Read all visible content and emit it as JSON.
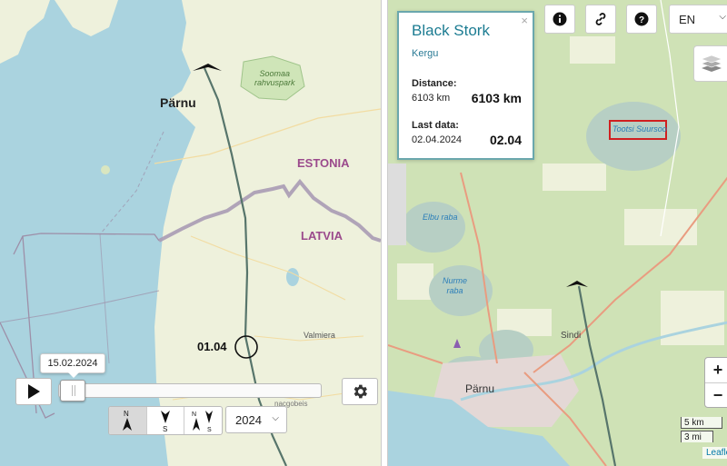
{
  "left_map": {
    "labels": {
      "parnu": "Pärnu",
      "soomaa": "Soomaa\nrahvuspark",
      "estonia": "ESTONIA",
      "latvia": "LATVIA",
      "valmiera": "Valmiera",
      "marker_date": "01.04",
      "bottom_town": "nacgobeis"
    },
    "colors": {
      "water": "#aad3df",
      "land": "#eef1dc",
      "border": "#9d8fa8",
      "track": "#57756b",
      "country_label": "#9b4a8c"
    }
  },
  "controls": {
    "date_tooltip": "15.02.2024",
    "play_icon": "play-icon",
    "settings_icon": "gear-icon",
    "direction_buttons": [
      {
        "icon": "north-arrow-icon",
        "letter": "N"
      },
      {
        "icon": "south-arrow-icon",
        "letter": "S"
      },
      {
        "icon": "north-south-arrows-icon",
        "letter": "NS"
      }
    ],
    "year": "2024"
  },
  "popup": {
    "title": "Black Stork",
    "subtitle": "Kergu",
    "close": "×",
    "distance_label": "Distance:",
    "distance_small": "6103 km",
    "distance_big": "6103 km",
    "last_data_label": "Last data:",
    "last_data_small": "02.04.2024",
    "last_data_big": "02.04"
  },
  "right_map": {
    "labels": {
      "tootsi": "Tootsi Suursoo",
      "elbu": "Elbu raba",
      "nurme": "Nurme\nraba",
      "sindi": "Sindi",
      "parnu": "Pärnu"
    }
  },
  "top_buttons": {
    "info_icon": "info-icon",
    "link_icon": "link-icon",
    "help_icon": "help-icon",
    "language": "EN"
  },
  "map_controls": {
    "layers_icon": "layers-icon",
    "zoom_in": "+",
    "zoom_out": "−",
    "scale_km": "5 km",
    "scale_mi": "3 mi",
    "attribution": "Leaflet"
  }
}
